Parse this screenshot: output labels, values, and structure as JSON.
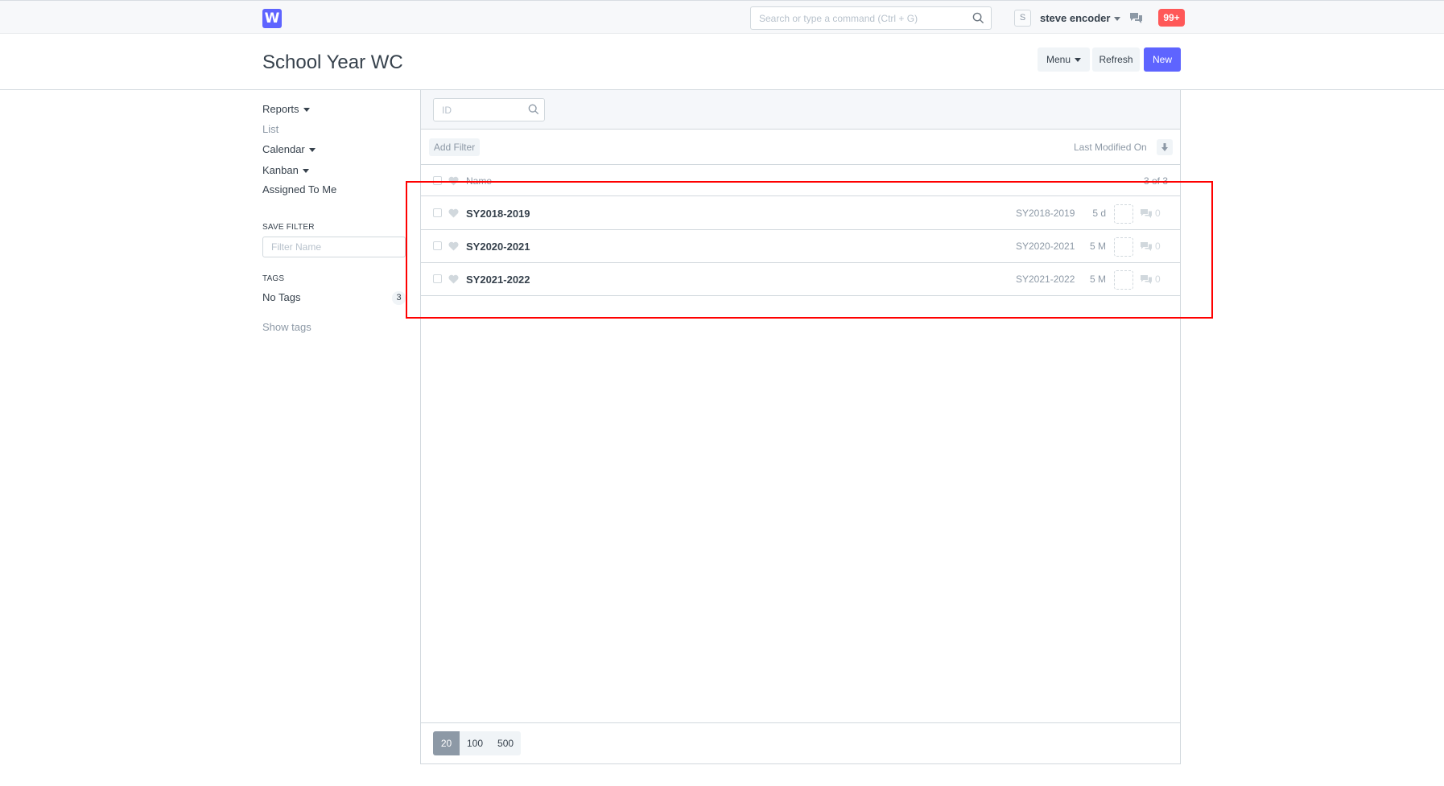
{
  "navbar": {
    "logo_letter": "W",
    "search_placeholder": "Search or type a command (Ctrl + G)",
    "avatar_letter": "S",
    "user_name": "steve encoder",
    "notification_count": "99+"
  },
  "page": {
    "title": "School Year WC",
    "menu_label": "Menu",
    "refresh_label": "Refresh",
    "new_label": "New"
  },
  "sidebar": {
    "reports": "Reports",
    "list": "List",
    "calendar": "Calendar",
    "kanban": "Kanban",
    "assigned_to_me": "Assigned To Me",
    "save_filter_heading": "SAVE FILTER",
    "filter_name_placeholder": "Filter Name",
    "tags_heading": "TAGS",
    "no_tags": "No Tags",
    "no_tags_count": "3",
    "show_tags": "Show tags"
  },
  "list": {
    "id_placeholder": "ID",
    "add_filter": "Add Filter",
    "sort_label": "Last Modified On",
    "header_name": "Name",
    "header_count": "3 of 3",
    "rows": [
      {
        "title": "SY2018-2019",
        "id": "SY2018-2019",
        "time": "5 d",
        "comments": "0"
      },
      {
        "title": "SY2020-2021",
        "id": "SY2020-2021",
        "time": "5 M",
        "comments": "0"
      },
      {
        "title": "SY2021-2022",
        "id": "SY2021-2022",
        "time": "5 M",
        "comments": "0"
      }
    ],
    "page_sizes": [
      "20",
      "100",
      "500"
    ]
  },
  "colors": {
    "primary": "#5e64ff",
    "badge": "#ff5858",
    "highlight": "#ff0000"
  }
}
